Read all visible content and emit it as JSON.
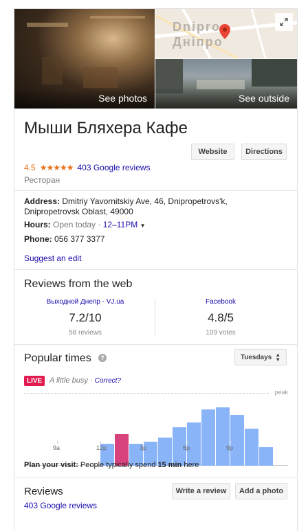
{
  "photos": {
    "see_photos_label": "See photos",
    "see_outside_label": "See outside",
    "map_text_latin": "Dnipro",
    "map_text_cyrillic": "Дніпро"
  },
  "place": {
    "name": "Мыши Бляхера Кафе",
    "rating": "4.5",
    "stars": "★★★★★",
    "reviews_link": "403 Google reviews",
    "category": "Ресторан"
  },
  "actions": {
    "website_label": "Website",
    "directions_label": "Directions"
  },
  "details": {
    "address_label": "Address:",
    "address_line1": "Dmitriy Yavornitskiy Ave, 46, Dnipropetrovs'k,",
    "address_line2": "Dnipropetrovsk Oblast, 49000",
    "hours_label": "Hours:",
    "hours_status": "Open today",
    "hours_separator": " · ",
    "hours_value": "12–11PM",
    "phone_label": "Phone:",
    "phone_value": "056 377 3377",
    "suggest_edit": "Suggest an edit"
  },
  "web_reviews": {
    "heading": "Reviews from the web",
    "sources": [
      {
        "name": "Выходной Днепр - VJ.ua",
        "score": "7.2/10",
        "count": "58 reviews"
      },
      {
        "name": "Facebook",
        "score": "4.8/5",
        "count": "109 votes"
      }
    ]
  },
  "popular_times": {
    "heading": "Popular times",
    "day_select": "Tuesdays",
    "live_badge": "LIVE",
    "busy_text": "A little busy",
    "separator": " · ",
    "correct_link": "Correct?",
    "peak_label": "peak",
    "hour_labels": [
      "9a",
      "12p",
      "3p",
      "6p",
      "9p"
    ],
    "bars": [
      0,
      0,
      0,
      0,
      0,
      0,
      0,
      0,
      0,
      0,
      0,
      0,
      0.31,
      0.45,
      0.31,
      0.34,
      0.4,
      0.55,
      0.62,
      0.8,
      0.83,
      0.73,
      0.53,
      0.26
    ],
    "live_hour_index": 13,
    "colors": {
      "bar": "#8ab4f8",
      "live": "#d8427d",
      "live_badge": "#e11a50"
    }
  },
  "plan": {
    "label": "Plan your visit:",
    "text_before": " People typically spend ",
    "duration": "15 min",
    "text_after": " here"
  },
  "reviews": {
    "heading": "Reviews",
    "write_label": "Write a review",
    "photo_label": "Add a photo",
    "link": "403 Google reviews"
  }
}
